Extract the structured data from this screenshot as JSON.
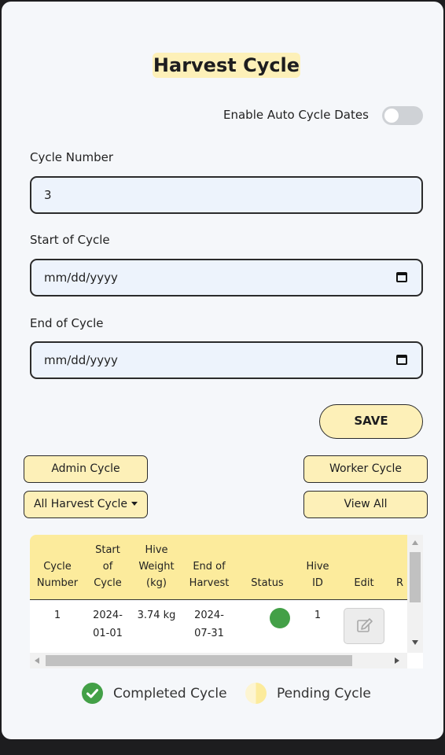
{
  "page": {
    "title": "Harvest Cycle",
    "auto_dates_label": "Enable Auto Cycle Dates",
    "auto_dates_enabled": false
  },
  "form": {
    "cycle_number_label": "Cycle Number",
    "cycle_number_value": "3",
    "start_label": "Start of Cycle",
    "start_placeholder": "mm/dd/yyyy",
    "end_label": "End of Cycle",
    "end_placeholder": "mm/dd/yyyy",
    "save_label": "SAVE"
  },
  "buttons": {
    "admin_cycle": "Admin Cycle",
    "worker_cycle": "Worker Cycle",
    "all_harvest_cycle": "All Harvest Cycle",
    "view_all": "View All"
  },
  "table": {
    "headers": {
      "cycle_number": [
        "Cycle",
        "Number"
      ],
      "start_of_cycle": [
        "Start",
        "of",
        "Cycle"
      ],
      "hive_weight": [
        "Hive",
        "Weight",
        "(kg)"
      ],
      "end_of_harvest": [
        "End of",
        "Harvest"
      ],
      "status": "Status",
      "hive_id": [
        "Hive",
        "ID"
      ],
      "edit": "Edit",
      "truncated": "R"
    },
    "rows": [
      {
        "cycle_number": "1",
        "start": [
          "2024-",
          "01-01"
        ],
        "hive_weight": "3.74 kg",
        "end": [
          "2024-",
          "07-31"
        ],
        "status": "completed",
        "hive_id": "1"
      }
    ]
  },
  "legend": {
    "completed": "Completed Cycle",
    "pending": "Pending Cycle"
  },
  "colors": {
    "accent_yellow": "#fdf0b8",
    "header_yellow": "#fceb9c",
    "status_completed": "#43a047",
    "input_bg": "#edf3fc"
  }
}
